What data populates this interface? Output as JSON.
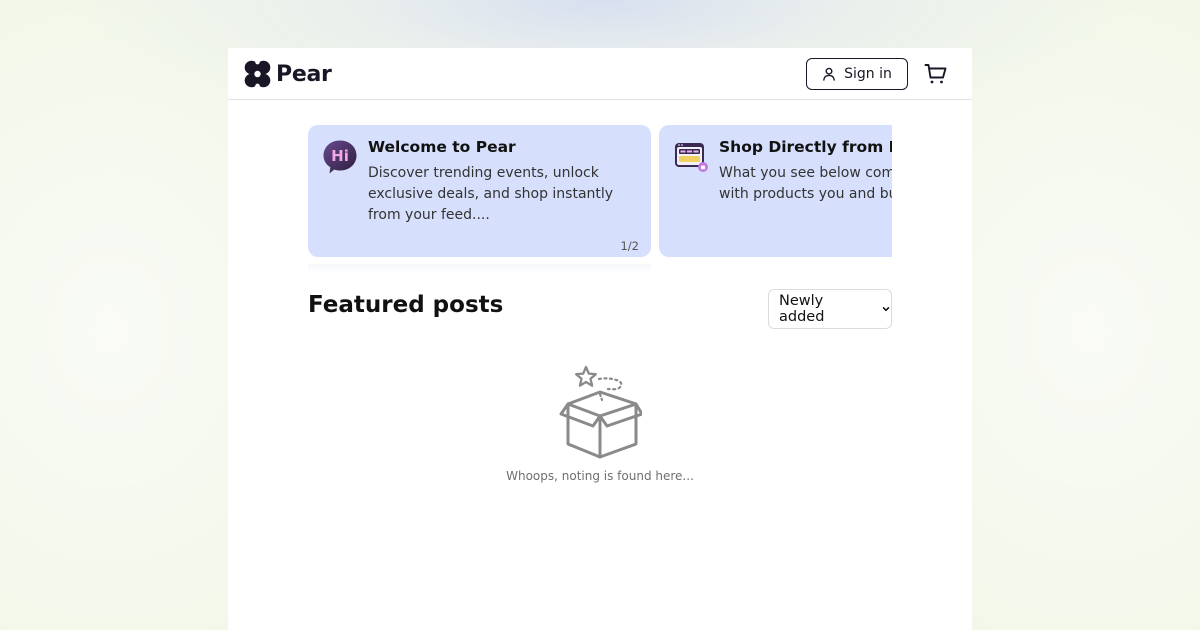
{
  "brand": {
    "name": "Pear"
  },
  "header": {
    "signin_label": "Sign in"
  },
  "carousel": {
    "cards": [
      {
        "title": "Welcome to Pear",
        "text": "Discover trending events, unlock exclusive deals, and shop instantly from your feed....",
        "pager": "1/2",
        "icon": "hi-speech-bubble-icon"
      },
      {
        "title": "Shop Directly from Pos",
        "text": "What you see below comb content with products you and buy instantly.",
        "icon": "shopping-browser-icon"
      }
    ]
  },
  "featured": {
    "title": "Featured posts",
    "sort_selected": "Newly added"
  },
  "empty_state": {
    "message": "Whoops, noting is found here...",
    "icon": "empty-box-icon"
  },
  "colors": {
    "card_background": "#d6e0fc",
    "brand_dark": "#1a1626",
    "page_background": "#f2f7e9"
  }
}
